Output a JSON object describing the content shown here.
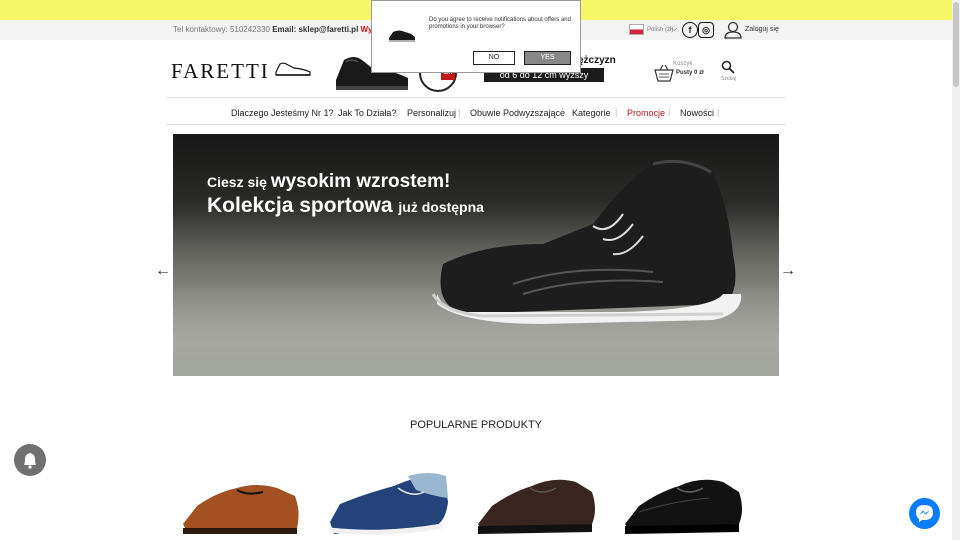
{
  "notification_dialog": {
    "message": "Do you agree to receive notifications about offers and promotions in your browser?",
    "no_label": "NO",
    "yes_label": "YES"
  },
  "topbar": {
    "phone_label": "Tel kontaktowy:",
    "phone": "510242330",
    "email_label": "Email:",
    "email": "sklep@faretti.pl",
    "shipping": "Wysyłka w 2",
    "language": "Polish (zł)",
    "login": "Zaloguj się"
  },
  "header": {
    "logo": "FARETTI",
    "badge_text": "cm",
    "tagline_fragment": "ężczyzn",
    "promo_box": "od 6 do 12 cm wyższy",
    "cart_label": "Koszyk",
    "cart_value": "Pusty 0 zł",
    "search_label": "Szukaj"
  },
  "nav": {
    "items": [
      {
        "label": "Dlaczego Jesteśmy Nr 1?"
      },
      {
        "label": "Jak To Działa?"
      },
      {
        "label": "Personalizuj"
      },
      {
        "label": "Obuwie Podwyższające"
      },
      {
        "label": "Kategorie"
      },
      {
        "label": "Promocje"
      },
      {
        "label": "Nowości"
      }
    ]
  },
  "hero": {
    "line1_a": "Ciesz się ",
    "line1_b": "wysokim wzrostem!",
    "line2_a": "Kolekcja sportowa ",
    "line2_b": "już dostępna"
  },
  "section": {
    "title": "POPULARNE PRODUKTY"
  },
  "colors": {
    "banner": "#f8f76a",
    "accent_red": "#c0171b",
    "messenger_blue": "#0a7cff"
  },
  "icons": [
    "facebook-icon",
    "instagram-icon",
    "user-icon",
    "cart-icon",
    "search-icon",
    "bell-icon",
    "messenger-icon",
    "arrow-left-icon",
    "arrow-right-icon",
    "chevron-down-icon"
  ]
}
